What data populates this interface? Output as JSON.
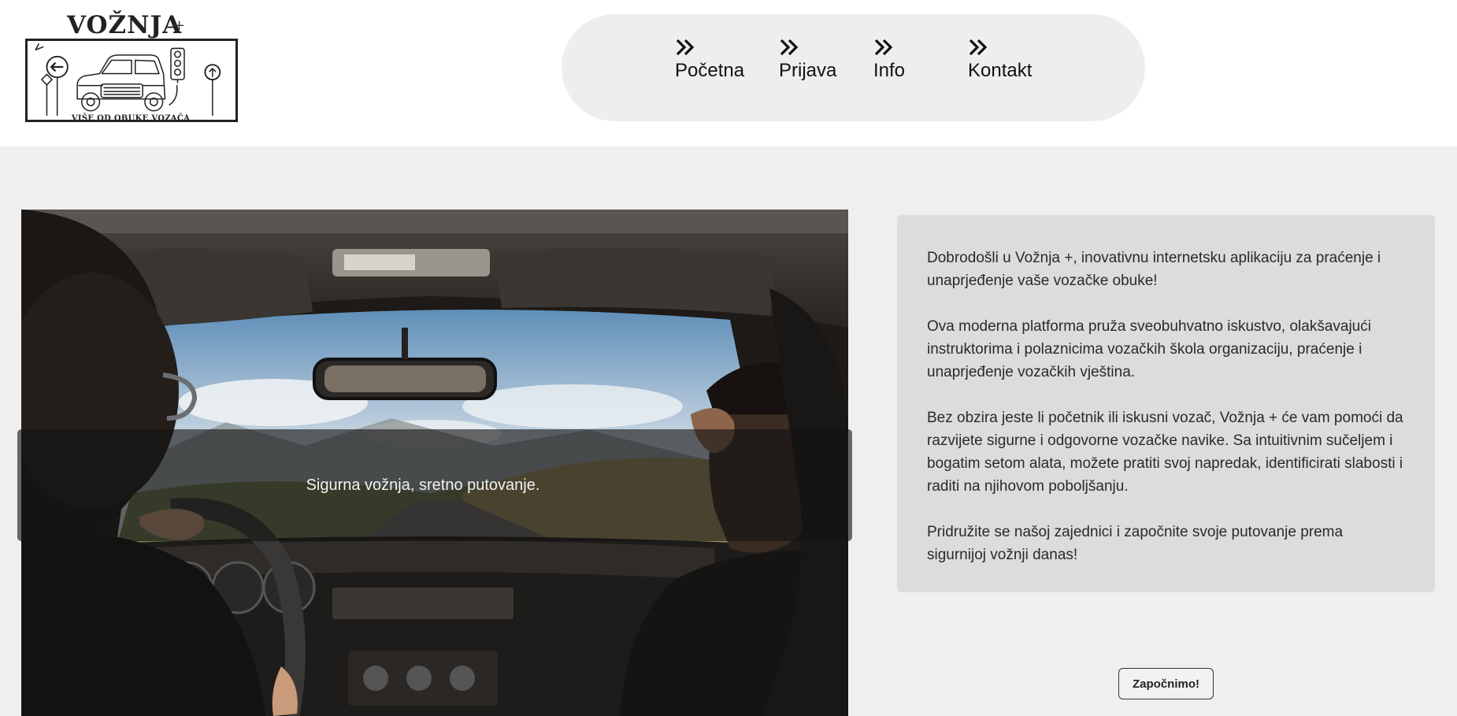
{
  "brand": {
    "title": "VOŽNJA",
    "plus": "+",
    "tagline": "VIŠE OD OBUKE VOZAČA"
  },
  "nav": {
    "items": [
      {
        "label": "Početna",
        "icon": "double-chevron-right-icon"
      },
      {
        "label": "Prijava",
        "icon": "double-chevron-right-icon"
      },
      {
        "label": "Info",
        "icon": "double-chevron-right-icon"
      },
      {
        "label": "Kontakt",
        "icon": "double-chevron-right-icon"
      }
    ]
  },
  "hero": {
    "caption": "Sigurna vožnja, sretno putovanje."
  },
  "info": {
    "paragraphs": [
      "Dobrodošli u Vožnja +, inovativnu internetsku aplikaciju za praćenje i unaprjeđenje vaše vozačke obuke!",
      "Ova moderna platforma pruža sveobuhvatno iskustvo, olakšavajući instruktorima i polaznicima vozačkih škola organizaciju, praćenje i unaprjeđenje vozačkih vještina.",
      "Bez obzira jeste li početnik ili iskusni vozač, Vožnja + će vam pomoći da razvijete sigurne i odgovorne vozačke navike. Sa intuitivnim sučeljem i bogatim setom alata, možete pratiti svoj napredak, identificirati slabosti i raditi na njihovom poboljšanju.",
      "Pridružite se našoj zajednici i započnite svoje putovanje prema sigurnijoj vožnji danas!"
    ]
  },
  "cta": {
    "label": "Započnimo!"
  },
  "colors": {
    "page_background": "#efefef",
    "header_background": "#ffffff",
    "nav_pill": "#eeeeee",
    "info_card": "#dcdcdc"
  }
}
